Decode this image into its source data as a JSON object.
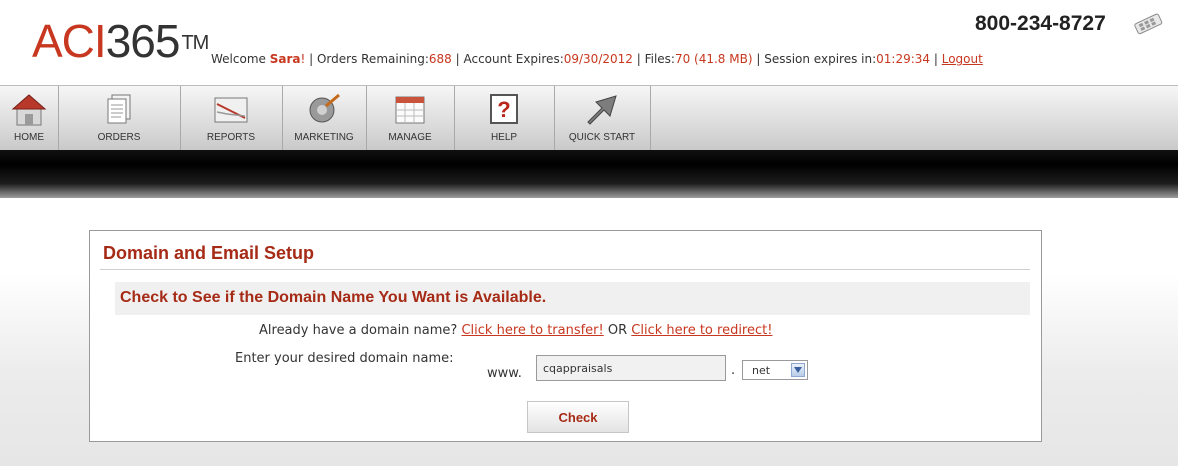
{
  "logo": {
    "brand_aci": "ACI",
    "brand_num": "365",
    "tm": "TM"
  },
  "header": {
    "phone": "800-234-8727",
    "status": {
      "welcome_prefix": "Welcome ",
      "user_name": "Sara",
      "welcome_suffix": "!",
      "sep": " | ",
      "orders_label": "Orders Remaining:",
      "orders_value": "688",
      "expires_label": "Account Expires:",
      "expires_value": "09/30/2012",
      "files_label": "Files:",
      "files_value": "70 (41.8 MB)",
      "session_label": "Session expires in:",
      "session_value": "01:29:34",
      "logout": "Logout"
    }
  },
  "toolbar": {
    "items": [
      {
        "label": "HOME",
        "icon": "home-icon"
      },
      {
        "label": "ORDERS",
        "icon": "orders-icon"
      },
      {
        "label": "REPORTS",
        "icon": "reports-icon"
      },
      {
        "label": "MARKETING",
        "icon": "marketing-icon"
      },
      {
        "label": "MANAGE",
        "icon": "manage-icon"
      },
      {
        "label": "HELP",
        "icon": "help-icon"
      },
      {
        "label": "QUICK START",
        "icon": "quick-start-icon"
      }
    ]
  },
  "panel": {
    "title": "Domain and Email Setup",
    "subheader": "Check to See if the Domain Name You Want is Available.",
    "already_text": "Already have a domain name?",
    "transfer_link": "Click here to transfer!",
    "or_text": "OR",
    "redirect_link": "Click here to redirect!",
    "enter_label": "Enter your desired domain name:",
    "www_prefix": "www.",
    "domain_value": "cqappraisals",
    "dot": ".",
    "tld_selected": "net",
    "check_button": "Check"
  },
  "colors": {
    "accent_red": "#c8371f",
    "title_red": "#a62b16"
  }
}
